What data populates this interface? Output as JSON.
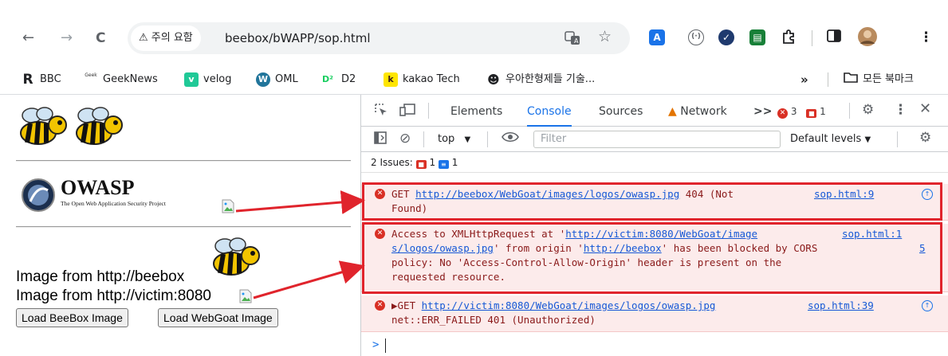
{
  "browser": {
    "nav": {
      "back": "←",
      "forward": "→",
      "reload": "C"
    },
    "security_chip": {
      "icon": "⚠",
      "label": "주의 요함"
    },
    "url": "beebox/bWAPP/sop.html",
    "omnibox_icons": [
      "translate-icon",
      "star-icon"
    ],
    "extensions": [
      {
        "name": "translate-ext",
        "text": "A",
        "color": "#1a73e8"
      },
      {
        "name": "code-ext",
        "text": "(·)",
        "color": "#5f6368"
      },
      {
        "name": "check-ext",
        "text": "✓",
        "color": "#1f3a6e"
      },
      {
        "name": "green-ext",
        "text": "▤",
        "color": "#188038"
      }
    ],
    "menu_icon": "⋮"
  },
  "bookmarks": [
    {
      "label": "BBC",
      "fav": "R"
    },
    {
      "label": "GeekNews",
      "fav": "Geek"
    },
    {
      "label": "velog",
      "fav": "v"
    },
    {
      "label": "OML",
      "fav": "W"
    },
    {
      "label": "D2",
      "fav": "D²"
    },
    {
      "label": "kakao Tech",
      "fav": "k"
    },
    {
      "label": "우아한형제들 기술...",
      "fav": "☻"
    }
  ],
  "bookmarks_more": "»",
  "bookmarks_folder": "모든 북마크",
  "page": {
    "owasp_title": "OWASP",
    "owasp_subtitle": "The Open Web Application Security Project",
    "line1": "Image from http://beebox",
    "line2": "Image from http://victim:8080",
    "btn_beebox": "Load BeeBox Image",
    "btn_webgoat": "Load WebGoat Image"
  },
  "devtools": {
    "tabs": [
      "Elements",
      "Console",
      "Sources",
      "Network"
    ],
    "active_tab": "Console",
    "more_tabs": ">>",
    "error_count": "3",
    "issue_count": "1",
    "context": "top",
    "filter_placeholder": "Filter",
    "levels": "Default levels",
    "issues_label": "2 Issues:",
    "issues_red": "1",
    "issues_blue": "1",
    "messages": [
      {
        "line1_pre": "GET ",
        "line1_link": "http://beebox/WebGoat/images/logos/owasp.jpg",
        "line1_post": " 404 (Not",
        "line2": "Found)",
        "source": "sop.html:9"
      },
      {
        "line1_pre": "Access to XMLHttpRequest at '",
        "line1_link": "http://victim:8080/WebGoat/image",
        "source_a": "sop.html:1",
        "line2_link": "s/logos/owasp.jpg",
        "line2_mid": "' from origin '",
        "line2_link2": "http://beebox",
        "line2_post": "' has been blocked by CORS",
        "line3": "policy: No 'Access-Control-Allow-Origin' header is present on the",
        "line4": "requested resource.",
        "source_b": "5"
      },
      {
        "line1_pre": "▶GET ",
        "line1_link": "http://victim:8080/WebGoat/images/logos/owasp.jpg",
        "line2": "net::ERR_FAILED 401 (Unauthorized)",
        "source": "sop.html:39"
      }
    ],
    "prompt": ">"
  }
}
